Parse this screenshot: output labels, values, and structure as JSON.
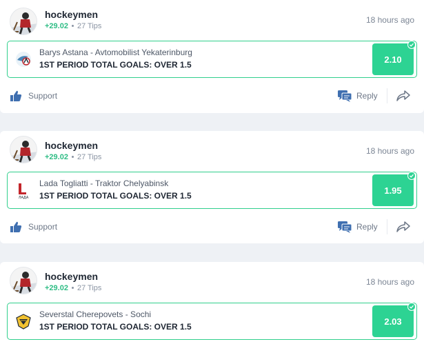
{
  "posts": [
    {
      "username": "hockeymen",
      "profit": "+29.02",
      "tips": "27 Tips",
      "time": "18 hours ago",
      "match": "Barys Astana - Avtomobilist Yekaterinburg",
      "prediction": "1ST PERIOD TOTAL GOALS: OVER 1.5",
      "odds": "2.10",
      "logo_icon": "barys-astana-logo-icon",
      "support_label": "Support",
      "reply_label": "Reply"
    },
    {
      "username": "hockeymen",
      "profit": "+29.02",
      "tips": "27 Tips",
      "time": "18 hours ago",
      "match": "Lada Togliatti - Traktor Chelyabinsk",
      "prediction": "1ST PERIOD TOTAL GOALS: OVER 1.5",
      "odds": "1.95",
      "logo_icon": "lada-togliatti-logo-icon",
      "support_label": "Support",
      "reply_label": "Reply"
    },
    {
      "username": "hockeymen",
      "profit": "+29.02",
      "tips": "27 Tips",
      "time": "18 hours ago",
      "match": "Severstal Cherepovets - Sochi",
      "prediction": "1ST PERIOD TOTAL GOALS: OVER 1.5",
      "odds": "2.03",
      "logo_icon": "severstal-logo-icon"
    }
  ],
  "colors": {
    "accent": "#2dd393",
    "profit": "#2fbd85",
    "text_dark": "#1f2733",
    "text_muted": "#8a94a3",
    "background": "#eef1f5"
  }
}
